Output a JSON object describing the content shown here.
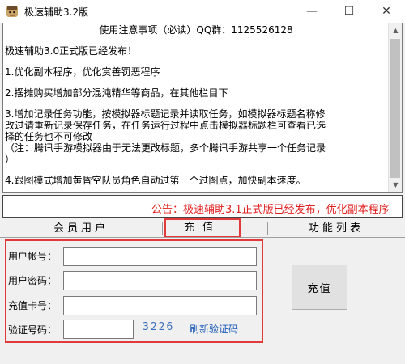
{
  "window": {
    "title": "极速辅助3.2版",
    "controls": {
      "minimize": "—",
      "maximize": "☐",
      "close": "✕"
    },
    "icon": "miner-avatar-icon"
  },
  "notice": {
    "lines": [
      "使用注意事项（必读）QQ群：1125526128",
      "极速辅助3.0正式版已经发布！",
      "1.优化副本程序，优化赏善罚恶程序",
      "2.摆摊购买增加部分混沌精华等商品，在其他栏目下",
      "3.增加记录任务功能，按模拟器标题记录并读取任务，如模拟器标题名称修",
      "改过请重新记录保存任务，在任务运行过程中点击模拟器标题栏可查看已选",
      "择的任务也不可修改",
      "（注：腾讯手游模拟器由于无法更改标题，多个腾讯手游共享一个任务记录",
      "）",
      "4.跟图模式增加黄昏空队员角色自动过第一个过图点，加快副本速度。"
    ]
  },
  "ticker": {
    "text": "公告：极速辅助3.1正式版已经发布，优化副本程序"
  },
  "tabs": {
    "member": "会员用户",
    "recharge": "充值",
    "functions": "功能列表"
  },
  "form": {
    "account_label": "用户帐号：",
    "account_value": "",
    "password_label": "用户密码：",
    "password_value": "",
    "card_label": "充值卡号：",
    "card_value": "",
    "captcha_label": "验证号码：",
    "captcha_value": "",
    "captcha_code": "3226",
    "refresh_label": "刷新验证码"
  },
  "recharge_button": {
    "label": "充值"
  },
  "colors": {
    "highlight_border": "#e03a3a",
    "ticker_text": "#e02020",
    "link": "#1d5bb8"
  }
}
